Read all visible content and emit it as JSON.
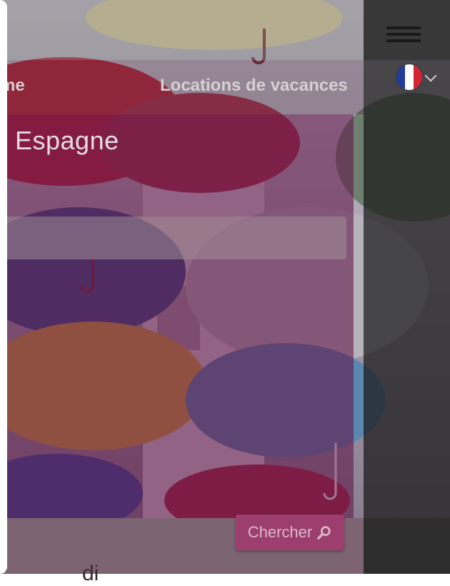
{
  "header": {
    "menu_icon": "hamburger-icon"
  },
  "nav": {
    "items": [
      {
        "label": "me"
      },
      {
        "label": "Locations de vacances"
      }
    ]
  },
  "language": {
    "flag": "flag-france-icon",
    "chevron": "chevron-down-icon",
    "colors": [
      "#1f3d99",
      "#ffffff",
      "#d22630"
    ]
  },
  "search": {
    "title": "Espagne",
    "input_value": "",
    "button_label": "Chercher",
    "button_icon": "search-icon"
  },
  "footer": {
    "partial_text": "di"
  },
  "colors": {
    "card_overlay": "#5f1446",
    "button": "#9c3f6e",
    "right_panel": "#191919"
  }
}
